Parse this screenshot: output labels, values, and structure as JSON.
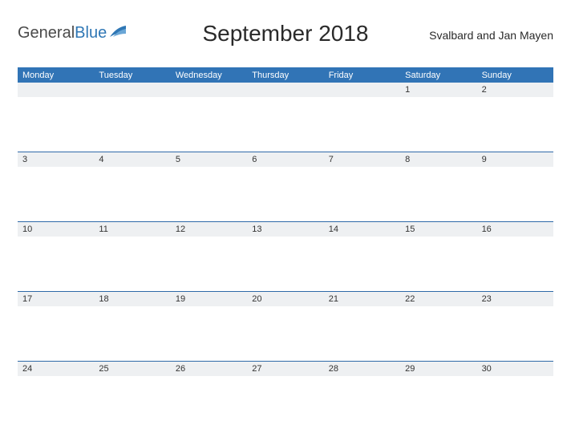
{
  "brand": {
    "part1": "General",
    "part2": "Blue"
  },
  "title": "September 2018",
  "region": "Svalbard and Jan Mayen",
  "colors": {
    "accent": "#3174b6",
    "rule": "#2f6aa8",
    "strip": "#eef0f2"
  },
  "daysOfWeek": [
    "Monday",
    "Tuesday",
    "Wednesday",
    "Thursday",
    "Friday",
    "Saturday",
    "Sunday"
  ],
  "weeks": [
    [
      "",
      "",
      "",
      "",
      "",
      "1",
      "2"
    ],
    [
      "3",
      "4",
      "5",
      "6",
      "7",
      "8",
      "9"
    ],
    [
      "10",
      "11",
      "12",
      "13",
      "14",
      "15",
      "16"
    ],
    [
      "17",
      "18",
      "19",
      "20",
      "21",
      "22",
      "23"
    ],
    [
      "24",
      "25",
      "26",
      "27",
      "28",
      "29",
      "30"
    ]
  ]
}
